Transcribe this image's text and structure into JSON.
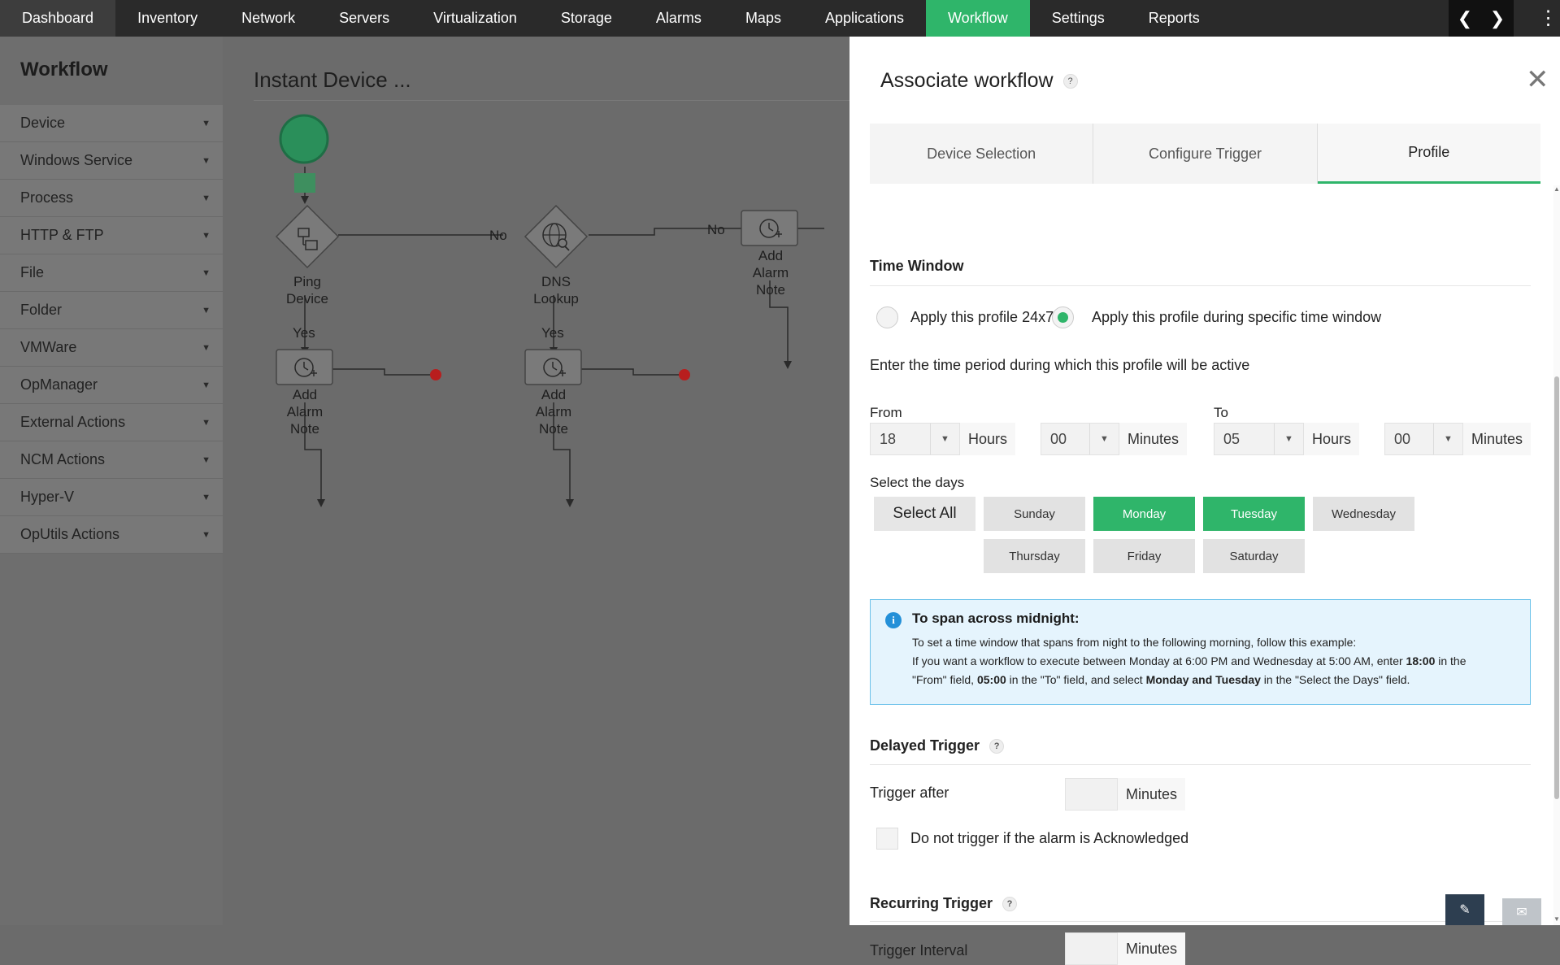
{
  "nav": {
    "items": [
      "Dashboard",
      "Inventory",
      "Network",
      "Servers",
      "Virtualization",
      "Storage",
      "Alarms",
      "Maps",
      "Applications",
      "Workflow",
      "Settings",
      "Reports"
    ],
    "active": "Workflow"
  },
  "sidebar": {
    "title": "Workflow",
    "items": [
      "Device",
      "Windows Service",
      "Process",
      "HTTP & FTP",
      "File",
      "Folder",
      "VMWare",
      "OpManager",
      "External Actions",
      "NCM Actions",
      "Hyper-V",
      "OpUtils Actions"
    ]
  },
  "canvas": {
    "title": "Instant Device ...",
    "nodes": {
      "ping": "Ping Device",
      "dns": "DNS Lookup",
      "note_top": "Add Alarm Note",
      "note_left": "Add Alarm Note",
      "note_mid": "Add Alarm Note"
    },
    "edges": {
      "no": "No",
      "yes": "Yes"
    }
  },
  "panel": {
    "title": "Associate workflow",
    "help": "?",
    "close": "✕",
    "tabs": [
      "Device Selection",
      "Configure Trigger",
      "Profile"
    ],
    "active_tab": "Profile",
    "time_window": {
      "title": "Time Window",
      "opt_24x7": "Apply this profile 24x7",
      "opt_specific": "Apply this profile during specific time window",
      "selected": "specific",
      "hint": "Enter the time period during which this profile will be active",
      "from_label": "From",
      "to_label": "To",
      "from_hours": "18",
      "from_minutes": "00",
      "to_hours": "05",
      "to_minutes": "00",
      "hours_unit": "Hours",
      "minutes_unit": "Minutes",
      "days_label": "Select the days",
      "select_all": "Select All",
      "days": [
        "Sunday",
        "Monday",
        "Tuesday",
        "Wednesday",
        "Thursday",
        "Friday",
        "Saturday"
      ],
      "selected_days": [
        "Monday",
        "Tuesday"
      ]
    },
    "info": {
      "icon": "i",
      "title": "To span across midnight:",
      "line1": "To set a time window that spans from night to the following morning, follow this example:",
      "line2_a": "If you want a workflow to execute between Monday at 6:00 PM and Wednesday at 5:00 AM, enter ",
      "line2_b": "18:00",
      "line2_c": " in the",
      "line3_a": "\"From\" field, ",
      "line3_b": "05:00",
      "line3_c": " in the \"To\" field, and select ",
      "line3_d": "Monday and Tuesday",
      "line3_e": " in the \"Select the Days\" field."
    },
    "delayed": {
      "title": "Delayed Trigger",
      "trigger_after": "Trigger after",
      "minutes": "Minutes",
      "value": "",
      "ack_label": "Do not trigger if the alarm is Acknowledged"
    },
    "recurring": {
      "title": "Recurring Trigger",
      "interval": "Trigger Interval",
      "minutes": "Minutes",
      "value": ""
    }
  },
  "colors": {
    "accent": "#2fb56a",
    "nav_bg": "#2a2a2a",
    "info_bg": "#e5f4fd",
    "info_border": "#6cc2ea"
  }
}
